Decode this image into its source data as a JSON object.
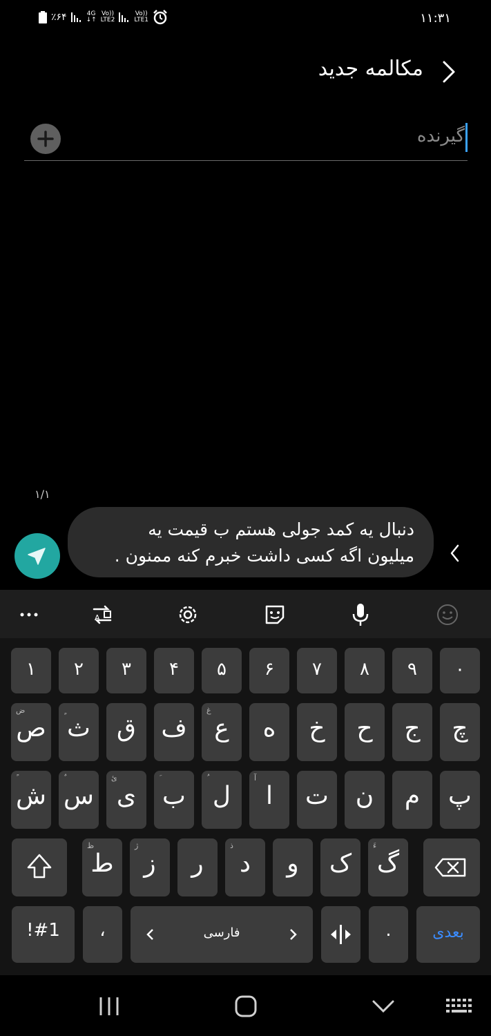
{
  "status_bar": {
    "battery": "٪۶۴",
    "net1": "4G",
    "net2_top": "Vo))",
    "net2_bottom": "LTE2",
    "net3_top": "Vo))",
    "net3_bottom": "LTE1",
    "time": "۱۱:۳۱"
  },
  "header": {
    "title": "مکالمه جدید"
  },
  "recipient": {
    "placeholder": "گیرنده"
  },
  "compose": {
    "counter": "۱/۱",
    "message_line1": "دنبال یه کمد جولی هستم ب قیمت یه",
    "message_line2": "میلیون اگه کسی داشت خبرم کنه ممنون ."
  },
  "keyboard": {
    "number_row": [
      "۱",
      "۲",
      "۳",
      "۴",
      "۵",
      "۶",
      "۷",
      "۸",
      "۹",
      "۰"
    ],
    "row1": [
      {
        "main": "ص",
        "sub": "ض"
      },
      {
        "main": "ث",
        "sub": "ٍ"
      },
      {
        "main": "ق",
        "sub": ""
      },
      {
        "main": "ف",
        "sub": ""
      },
      {
        "main": "ع",
        "sub": "غ"
      },
      {
        "main": "ه",
        "sub": ""
      },
      {
        "main": "خ",
        "sub": ""
      },
      {
        "main": "ح",
        "sub": ""
      },
      {
        "main": "ج",
        "sub": ""
      },
      {
        "main": "چ",
        "sub": ""
      }
    ],
    "row2": [
      {
        "main": "ش",
        "sub": "ً"
      },
      {
        "main": "س",
        "sub": "ٌ"
      },
      {
        "main": "ی",
        "sub": "ئ"
      },
      {
        "main": "ب",
        "sub": "َ"
      },
      {
        "main": "ل",
        "sub": "ُ"
      },
      {
        "main": "ا",
        "sub": "آ"
      },
      {
        "main": "ت",
        "sub": ""
      },
      {
        "main": "ن",
        "sub": ""
      },
      {
        "main": "م",
        "sub": ""
      },
      {
        "main": "پ",
        "sub": ""
      }
    ],
    "row3": [
      {
        "main": "ط",
        "sub": "ظ"
      },
      {
        "main": "ز",
        "sub": "ژ"
      },
      {
        "main": "ر",
        "sub": ""
      },
      {
        "main": "د",
        "sub": "ذ"
      },
      {
        "main": "و",
        "sub": ""
      },
      {
        "main": "ک",
        "sub": ""
      },
      {
        "main": "گ",
        "sub": "ءَ"
      }
    ],
    "symbols_label": "!#1",
    "comma_label": "،",
    "language_label": "فارسی",
    "period_label": ".",
    "next_label": "بعدی",
    "next_color": "#3b8cff"
  },
  "colors": {
    "send_button": "#22a7a1",
    "caret": "#3aa3ff",
    "key": "#3c3c3c"
  }
}
